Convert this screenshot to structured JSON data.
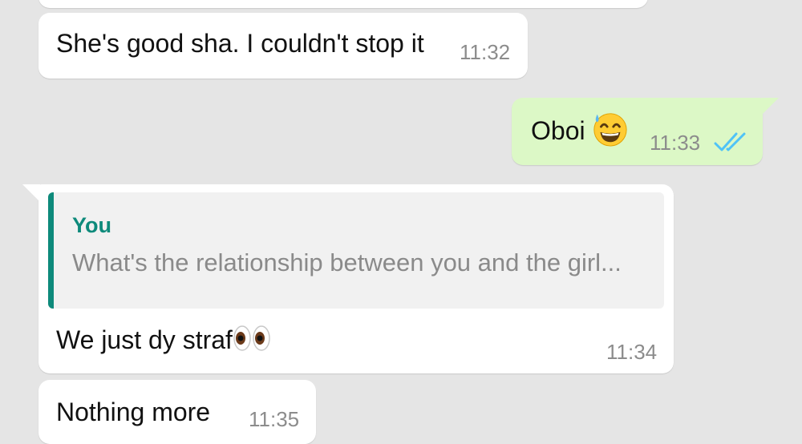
{
  "messages": [
    {
      "text": "She's good sha. I couldn't stop it",
      "time": "11:32"
    },
    {
      "text": "Oboi",
      "emoji": "sweat-smile-icon",
      "time": "11:33",
      "status": "read"
    },
    {
      "quote_author": "You",
      "quote_text": "What's the relationship between you and the girl...",
      "text": "We just dy straf",
      "emoji": "eyes-icon",
      "time": "11:34"
    },
    {
      "text": "Nothing more",
      "time": "11:35"
    }
  ],
  "colors": {
    "background": "#e5e5e5",
    "incoming_bubble": "#ffffff",
    "outgoing_bubble": "#dcf8c6",
    "quote_accent": "#0e8a7b",
    "read_ticks": "#4fc3f7"
  }
}
